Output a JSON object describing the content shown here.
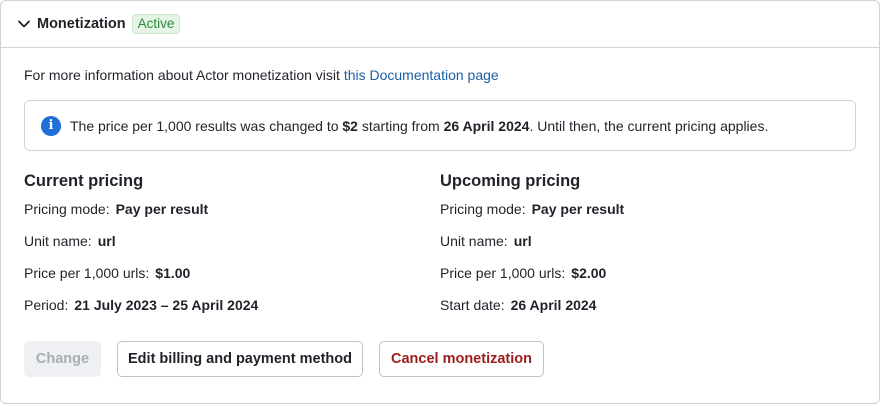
{
  "header": {
    "title": "Monetization",
    "badge": "Active"
  },
  "info": {
    "text": "For more information about Actor monetization visit ",
    "link": "this Documentation page"
  },
  "alert": {
    "part1": "The price per 1,000 results was changed to ",
    "price": "$2",
    "part2": " starting from ",
    "date": "26 April 2024",
    "part3": ". Until then, the current pricing applies."
  },
  "current": {
    "title": "Current pricing",
    "rows": [
      {
        "label": "Pricing mode:",
        "value": "Pay per result"
      },
      {
        "label": "Unit name:",
        "value": "url"
      },
      {
        "label": "Price per 1,000 urls:",
        "value": "$1.00"
      },
      {
        "label": "Period:",
        "value": "21 July 2023 – 25 April 2024"
      }
    ]
  },
  "upcoming": {
    "title": "Upcoming pricing",
    "rows": [
      {
        "label": "Pricing mode:",
        "value": "Pay per result"
      },
      {
        "label": "Unit name:",
        "value": "url"
      },
      {
        "label": "Price per 1,000 urls:",
        "value": "$2.00"
      },
      {
        "label": "Start date:",
        "value": "26 April 2024"
      }
    ]
  },
  "buttons": {
    "change": "Change",
    "edit": "Edit billing and payment method",
    "cancel": "Cancel monetization"
  }
}
